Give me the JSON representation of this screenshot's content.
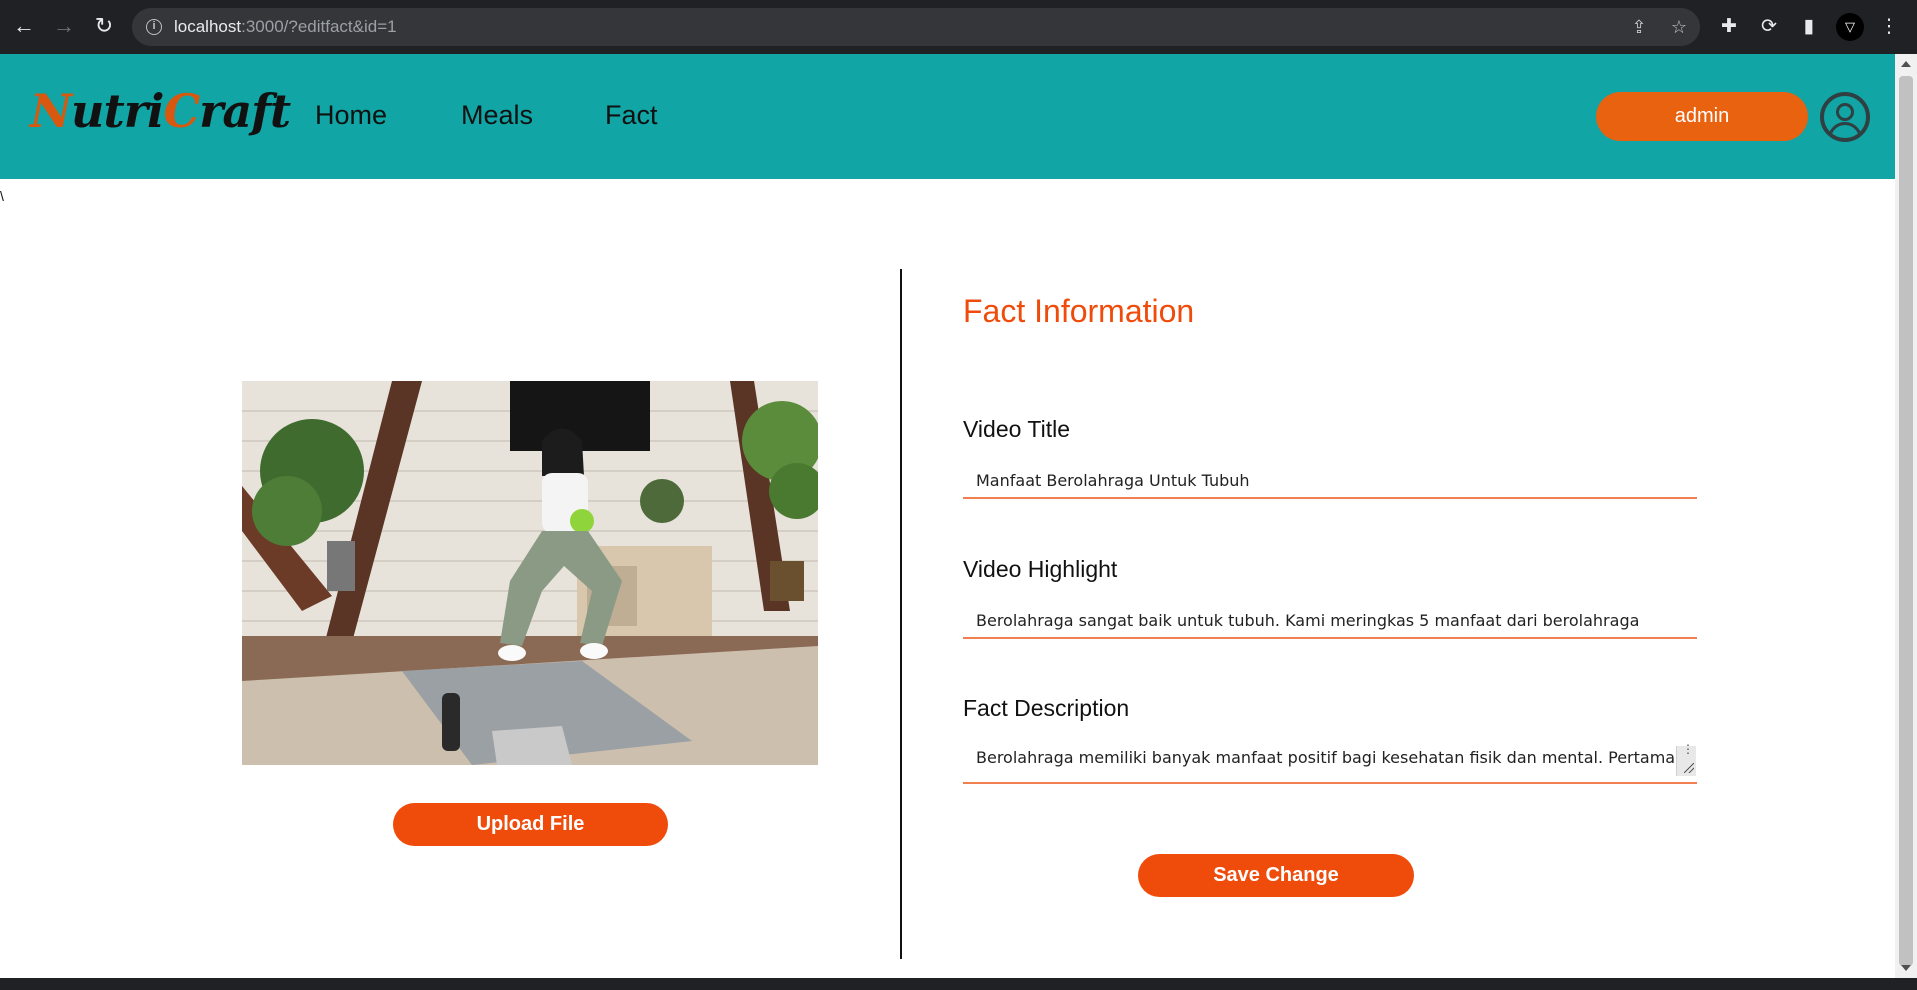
{
  "browser": {
    "url_host": "localhost",
    "url_rest": ":3000/?editfact&id=1",
    "icons": [
      "back-arrow-icon",
      "forward-arrow-icon",
      "reload-icon",
      "info-icon",
      "share-icon",
      "star-icon",
      "extensions-icon",
      "sync-icon",
      "side-panel-icon",
      "profile-icon",
      "menu-icon"
    ],
    "profile_glyph": "▽"
  },
  "navbar": {
    "logo": {
      "part1": "N",
      "part2": "utri",
      "part3": "C",
      "part4": "raft"
    },
    "links": [
      "Home",
      "Meals",
      "Fact"
    ],
    "user_label": "admin",
    "colors": {
      "background": "#11a5a5",
      "accent": "#e8620f"
    }
  },
  "stray_char": "\\",
  "left_panel": {
    "image_description_icon": "exercise-photo",
    "upload_label": "Upload File"
  },
  "form": {
    "title": "Fact Information",
    "fields": [
      {
        "label": "Video Title",
        "value": "Manfaat Berolahraga Untuk Tubuh"
      },
      {
        "label": "Video Highlight",
        "value": "Berolahraga sangat baik untuk tubuh. Kami meringkas 5 manfaat dari berolahraga"
      },
      {
        "label": "Fact Description",
        "value": "Berolahraga memiliki banyak manfaat positif bagi kesehatan fisik dan mental. Pertama,"
      }
    ],
    "save_label": "Save Change",
    "colors": {
      "title": "#ef4c0c",
      "button": "#ef4c0c",
      "underline": "#f08050"
    }
  }
}
